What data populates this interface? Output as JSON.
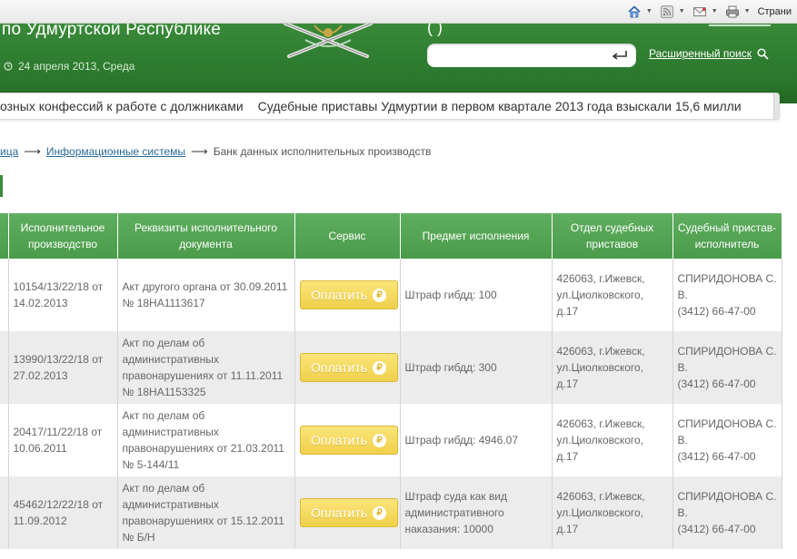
{
  "browser": {
    "pages_label": "Страни"
  },
  "header": {
    "title": "по Удмуртской Республике",
    "date": "24 апреля 2013, Среда",
    "top_fragment": "(      )",
    "search_placeholder": "",
    "advanced_search": "Расширенный поиск"
  },
  "ticker": {
    "items": [
      "озных конфессий к работе с должниками",
      "Судебные приставы Удмуртии в первом квартале 2013 года взыскали 15,6 милли"
    ]
  },
  "breadcrumb": {
    "home": "ица",
    "arrow": "⟶",
    "systems": "Информационные системы",
    "current": "Банк данных исполнительных производств"
  },
  "table": {
    "headers": [
      "",
      "Исполнительное производство",
      "Реквизиты исполнительного документа",
      "Сервис",
      "Предмет исполнения",
      "Отдел судебных приставов",
      "Судебный пристав-исполнитель"
    ],
    "pay_label": "Оплатить",
    "pay_icon_glyph": "₽",
    "rows": [
      {
        "case": "10154/13/22/18 от 14.02.2013",
        "document": "Акт другого органа от 30.09.2011 № 18НА1113617",
        "subject": "Штраф гибдд: 100",
        "department": "426063, г.Ижевск, ул.Циолковского, д.17",
        "bailiff_name": "СПИРИДОНОВА С. В.",
        "bailiff_phone": "(3412) 66-47-00"
      },
      {
        "case": "13990/13/22/18 от 27.02.2013",
        "document": "Акт по делам об административных правонарушениях от 11.11.2011 № 18НА1153325",
        "subject": "Штраф гибдд: 300",
        "department": "426063, г.Ижевск, ул.Циолковского, д.17",
        "bailiff_name": "СПИРИДОНОВА С. В.",
        "bailiff_phone": "(3412) 66-47-00"
      },
      {
        "case": "20417/11/22/18 от 10.06.2011",
        "document": "Акт по делам об административных правонарушениях от 21.03.2011 № 5-144/11",
        "subject": "Штраф гибдд: 4946.07",
        "department": "426063, г.Ижевск, ул.Циолковского, д.17",
        "bailiff_name": "СПИРИДОНОВА С. В.",
        "bailiff_phone": "(3412) 66-47-00"
      },
      {
        "case": "45462/12/22/18 от 11.09.2012",
        "document": "Акт по делам об административных правонарушениях от 15.12.2011 № Б/Н",
        "subject": "Штраф суда как вид административного наказания: 10000",
        "department": "426063, г.Ижевск, ул.Циолковского, д.17",
        "bailiff_name": "СПИРИДОНОВА С. В.",
        "bailiff_phone": "(3412) 66-47-00"
      }
    ]
  },
  "colors": {
    "header_green": "#2f7d30",
    "table_header_green": "#52a352",
    "pay_button_yellow": "#f3d757",
    "link_blue": "#2a6a9a"
  }
}
